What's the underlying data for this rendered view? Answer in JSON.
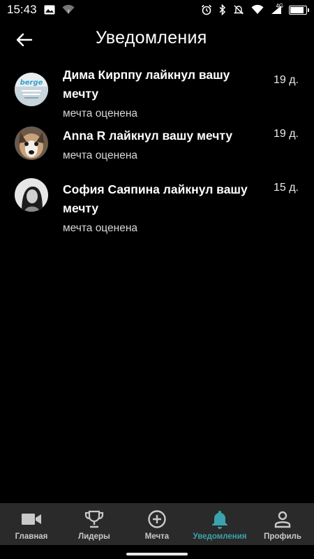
{
  "status_bar": {
    "time": "15:43",
    "network_label": "4G",
    "battery_level": 0.9
  },
  "header": {
    "title": "Уведомления"
  },
  "notifications": [
    {
      "title": "Дима Кирппу лайкнул вашу мечту",
      "subtitle": "мечта оценена",
      "age": "19 д.",
      "avatar_text": "berge"
    },
    {
      "title": "Anna R лайкнул вашу мечту",
      "subtitle": "мечта оценена",
      "age": "19 д."
    },
    {
      "title": "София Саяпина лайкнул вашу мечту",
      "subtitle": "мечта оценена",
      "age": "15 д."
    }
  ],
  "bottom_nav": {
    "items": [
      {
        "label": "Главная",
        "icon": "video-camera-icon"
      },
      {
        "label": "Лидеры",
        "icon": "trophy-icon"
      },
      {
        "label": "Мечта",
        "icon": "add-circle-icon"
      },
      {
        "label": "Уведомления",
        "icon": "bell-icon",
        "active": true
      },
      {
        "label": "Профиль",
        "icon": "person-icon"
      }
    ],
    "active_color": "#3aa3ad",
    "inactive_color": "#c9c9c9"
  }
}
